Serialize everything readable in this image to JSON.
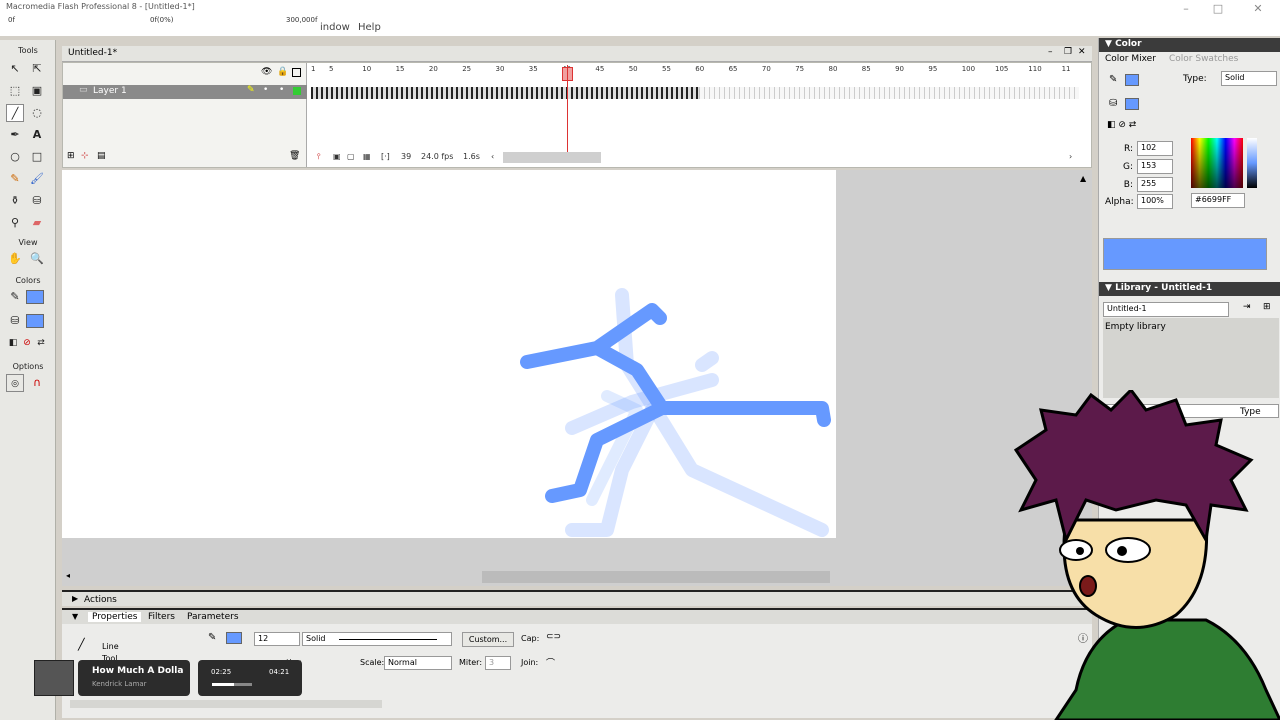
{
  "window": {
    "title": "Macromedia Flash Professional 8 - [Untitled-1*]",
    "caption_left": "0f",
    "caption_mid": "0f(0%)",
    "caption_right": "300,000f"
  },
  "menu": {
    "window": "indow",
    "help": "Help"
  },
  "tools": {
    "tools_label": "Tools",
    "view_label": "View",
    "colors_label": "Colors",
    "options_label": "Options"
  },
  "document": {
    "tab": "Untitled-1*"
  },
  "timeline": {
    "layer_name": "Layer 1",
    "ruler": [
      "1",
      "5",
      "10",
      "15",
      "20",
      "25",
      "30",
      "35",
      "40",
      "45",
      "50",
      "55",
      "60",
      "65",
      "70",
      "75",
      "80",
      "85",
      "90",
      "95",
      "100",
      "105",
      "110",
      "11"
    ],
    "current_frame": "39",
    "fps": "24.0 fps",
    "elapsed": "1.6s"
  },
  "panels": {
    "actions": "Actions"
  },
  "properties": {
    "tabs": [
      "Properties",
      "Filters",
      "Parameters"
    ],
    "tool_name": "Line",
    "tool_sub": "Tool",
    "stroke_size": "12",
    "stroke_style": "Solid",
    "custom_label": "Custom...",
    "cap_label": "Cap:",
    "join_label": "Join:",
    "scale_label": "Scale:",
    "scale_value": "Normal",
    "miter_label": "Miter:",
    "miter_value": "3",
    "hinting_label": "nting"
  },
  "player": {
    "song": "How Much A Dolla",
    "artist": "Kendrick Lamar",
    "elapsed": "02:25",
    "total": "04:21",
    "progress": 0.56
  },
  "color_panel": {
    "header": "Color",
    "tab_mixer": "Color Mixer",
    "tab_swatches": "Color Swatches",
    "type_label": "Type:",
    "type_value": "Solid",
    "r_label": "R:",
    "r_value": "102",
    "g_label": "G:",
    "g_value": "153",
    "b_label": "B:",
    "b_value": "255",
    "alpha_label": "Alpha:",
    "alpha_value": "100%",
    "hex": "#6699FF",
    "swatch_color": "#6699FF"
  },
  "library": {
    "header": "Library - Untitled-1",
    "doc": "Untitled-1",
    "empty": "Empty library",
    "type_col": "Type"
  },
  "colors": {
    "accent": "#6699FF",
    "playhead": "#DD3333"
  }
}
